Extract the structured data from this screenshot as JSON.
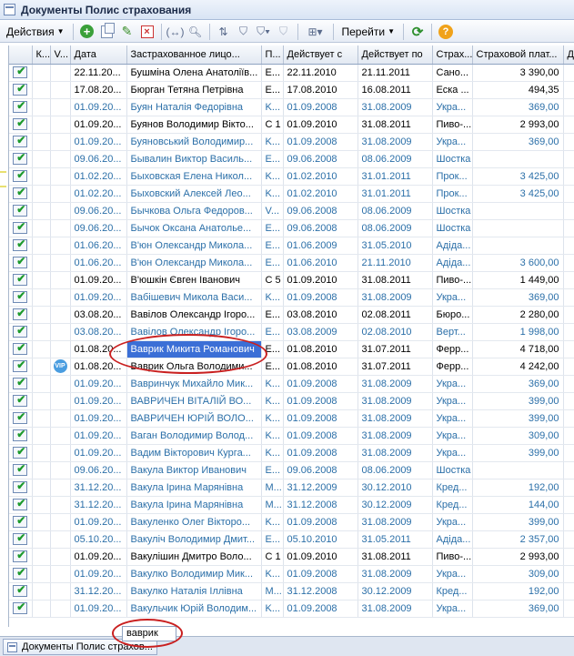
{
  "window": {
    "title": "Документы Полис страхования"
  },
  "toolbar": {
    "actions_label": "Действия",
    "goto_label": "Перейти",
    "help_label": "?"
  },
  "columns": [
    "",
    "К...",
    "V...",
    "Дата",
    "Застрахованное лицо...",
    "П...",
    "Действует с",
    "Действует по",
    "Страх...",
    "Страховой плат...",
    "Д"
  ],
  "rows": [
    {
      "date": "22.11.20...",
      "person": "Бушміна Олена Анатоліїв...",
      "p": "E...",
      "from": "22.11.2010",
      "to": "21.11.2011",
      "ins": "Сано...",
      "pay": "3 390,00",
      "posted": true
    },
    {
      "date": "17.08.20...",
      "person": "Бюрган Тетяна Петрівна",
      "p": "E...",
      "from": "17.08.2010",
      "to": "16.08.2011",
      "ins": "Еска ...",
      "pay": "494,35",
      "posted": true
    },
    {
      "date": "01.09.20...",
      "person": "Буян Наталія Федорівна",
      "p": "K...",
      "from": "01.09.2008",
      "to": "31.08.2009",
      "ins": "Укра...",
      "pay": "369,00",
      "posted": false
    },
    {
      "date": "01.09.20...",
      "person": "Буянов Володимир Вікто...",
      "p": "C 1",
      "from": "01.09.2010",
      "to": "31.08.2011",
      "ins": "Пиво-...",
      "pay": "2 993,00",
      "posted": true
    },
    {
      "date": "01.09.20...",
      "person": "Буяновський Володимир...",
      "p": "K...",
      "from": "01.09.2008",
      "to": "31.08.2009",
      "ins": "Укра...",
      "pay": "369,00",
      "posted": false
    },
    {
      "date": "09.06.20...",
      "person": "Бывалин Виктор Василь...",
      "p": "E...",
      "from": "09.06.2008",
      "to": "08.06.2009",
      "ins": "Шостка",
      "pay": "",
      "posted": false
    },
    {
      "date": "01.02.20...",
      "person": "Быховская Елена Никол...",
      "p": "K...",
      "from": "01.02.2010",
      "to": "31.01.2011",
      "ins": "Прок...",
      "pay": "3 425,00",
      "posted": false
    },
    {
      "date": "01.02.20...",
      "person": "Быховский Алексей Лео...",
      "p": "K...",
      "from": "01.02.2010",
      "to": "31.01.2011",
      "ins": "Прок...",
      "pay": "3 425,00",
      "posted": false
    },
    {
      "date": "09.06.20...",
      "person": "Бычкова Ольга Федоров...",
      "p": "V...",
      "from": "09.06.2008",
      "to": "08.06.2009",
      "ins": "Шостка",
      "pay": "",
      "posted": false
    },
    {
      "date": "09.06.20...",
      "person": "Бычок Оксана Анатолье...",
      "p": "E...",
      "from": "09.06.2008",
      "to": "08.06.2009",
      "ins": "Шостка",
      "pay": "",
      "posted": false
    },
    {
      "date": "01.06.20...",
      "person": "В'юн Олександр Микола...",
      "p": "E...",
      "from": "01.06.2009",
      "to": "31.05.2010",
      "ins": "Адіда...",
      "pay": "",
      "posted": false
    },
    {
      "date": "01.06.20...",
      "person": "В'юн Олександр Микола...",
      "p": "E...",
      "from": "01.06.2010",
      "to": "21.11.2010",
      "ins": "Адіда...",
      "pay": "3 600,00",
      "posted": false
    },
    {
      "date": "01.09.20...",
      "person": "В'юшкін Євген Іванович",
      "p": "C 5",
      "from": "01.09.2010",
      "to": "31.08.2011",
      "ins": "Пиво-...",
      "pay": "1 449,00",
      "posted": true
    },
    {
      "date": "01.09.20...",
      "person": "Вабішевич Микола Васи...",
      "p": "K...",
      "from": "01.09.2008",
      "to": "31.08.2009",
      "ins": "Укра...",
      "pay": "369,00",
      "posted": false
    },
    {
      "date": "03.08.20...",
      "person": "Вавілов Олександр Ігоро...",
      "p": "E...",
      "from": "03.08.2010",
      "to": "02.08.2011",
      "ins": "Бюро...",
      "pay": "2 280,00",
      "posted": true
    },
    {
      "date": "03.08.20...",
      "person": "Вавілов Олександр Ігоро...",
      "p": "E...",
      "from": "03.08.2009",
      "to": "02.08.2010",
      "ins": "Верт...",
      "pay": "1 998,00",
      "posted": false
    },
    {
      "date": "01.08.20...",
      "person": "Ваврик Микита Романович",
      "p": "E...",
      "from": "01.08.2010",
      "to": "31.07.2011",
      "ins": "Ферр...",
      "pay": "4 718,00",
      "posted": true,
      "selected": true
    },
    {
      "date": "01.08.20...",
      "person": "Ваврик Ольга Володими...",
      "p": "E...",
      "from": "01.08.2010",
      "to": "31.07.2011",
      "ins": "Ферр...",
      "pay": "4 242,00",
      "posted": true,
      "vip": "VIP"
    },
    {
      "date": "01.09.20...",
      "person": "Вавринчук Михайло Мик...",
      "p": "K...",
      "from": "01.09.2008",
      "to": "31.08.2009",
      "ins": "Укра...",
      "pay": "369,00",
      "posted": false
    },
    {
      "date": "01.09.20...",
      "person": "ВАВРИЧЕН ВІТАЛІЙ ВО...",
      "p": "K...",
      "from": "01.09.2008",
      "to": "31.08.2009",
      "ins": "Укра...",
      "pay": "399,00",
      "posted": false
    },
    {
      "date": "01.09.20...",
      "person": "ВАВРИЧЕН ЮРІЙ ВОЛО...",
      "p": "K...",
      "from": "01.09.2008",
      "to": "31.08.2009",
      "ins": "Укра...",
      "pay": "399,00",
      "posted": false
    },
    {
      "date": "01.09.20...",
      "person": "Ваган Володимир Волод...",
      "p": "K...",
      "from": "01.09.2008",
      "to": "31.08.2009",
      "ins": "Укра...",
      "pay": "309,00",
      "posted": false
    },
    {
      "date": "01.09.20...",
      "person": "Вадим Вікторович Курга...",
      "p": "K...",
      "from": "01.09.2008",
      "to": "31.08.2009",
      "ins": "Укра...",
      "pay": "399,00",
      "posted": false
    },
    {
      "date": "09.06.20...",
      "person": "Вакула Виктор Иванович",
      "p": "E...",
      "from": "09.06.2008",
      "to": "08.06.2009",
      "ins": "Шостка",
      "pay": "",
      "posted": false
    },
    {
      "date": "31.12.20...",
      "person": "Вакула Ірина Марянівна",
      "p": "M...",
      "from": "31.12.2009",
      "to": "30.12.2010",
      "ins": "Кред...",
      "pay": "192,00",
      "posted": false
    },
    {
      "date": "31.12.20...",
      "person": "Вакула Ірина Марянівна",
      "p": "M...",
      "from": "31.12.2008",
      "to": "30.12.2009",
      "ins": "Кред...",
      "pay": "144,00",
      "posted": false
    },
    {
      "date": "01.09.20...",
      "person": "Вакуленко Олег Вікторо...",
      "p": "K...",
      "from": "01.09.2008",
      "to": "31.08.2009",
      "ins": "Укра...",
      "pay": "399,00",
      "posted": false
    },
    {
      "date": "05.10.20...",
      "person": "Вакуліч Володимир Дмит...",
      "p": "E...",
      "from": "05.10.2010",
      "to": "31.05.2011",
      "ins": "Адіда...",
      "pay": "2 357,00",
      "posted": false
    },
    {
      "date": "01.09.20...",
      "person": "Вакулішин Дмитро Воло...",
      "p": "C 1",
      "from": "01.09.2010",
      "to": "31.08.2011",
      "ins": "Пиво-...",
      "pay": "2 993,00",
      "posted": true
    },
    {
      "date": "01.09.20...",
      "person": "Вакулко Володимир Мик...",
      "p": "K...",
      "from": "01.09.2008",
      "to": "31.08.2009",
      "ins": "Укра...",
      "pay": "309,00",
      "posted": false
    },
    {
      "date": "31.12.20...",
      "person": "Вакулко Наталія Іллівна",
      "p": "M...",
      "from": "31.12.2008",
      "to": "30.12.2009",
      "ins": "Кред...",
      "pay": "192,00",
      "posted": false
    },
    {
      "date": "01.09.20...",
      "person": "Вакульчик Юрій Володим...",
      "p": "K...",
      "from": "01.09.2008",
      "to": "31.08.2009",
      "ins": "Укра...",
      "pay": "369,00",
      "posted": false
    }
  ],
  "search": {
    "value": "ваврик"
  },
  "taskbar": {
    "tab_label": "Документы Полис страхов..."
  },
  "colors": {
    "draft_text": "#2b6fa8",
    "selection": "#3b6fd6",
    "annotation": "#c92020"
  }
}
